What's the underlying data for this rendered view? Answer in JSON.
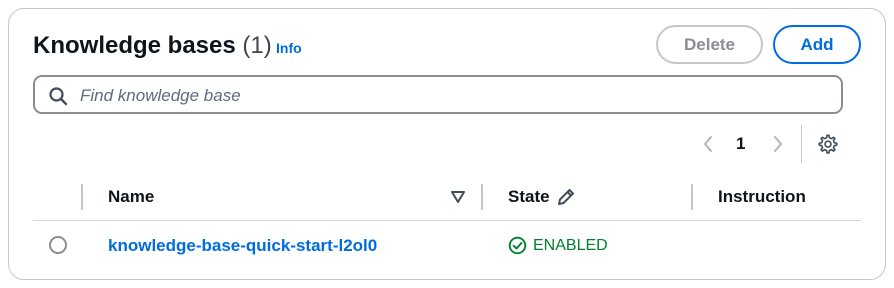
{
  "header": {
    "title": "Knowledge bases",
    "count": "(1)",
    "info_label": "Info",
    "delete_label": "Delete",
    "add_label": "Add"
  },
  "search": {
    "placeholder": "Find knowledge base"
  },
  "pagination": {
    "current_page": "1"
  },
  "table": {
    "columns": [
      "Name",
      "State",
      "Instruction"
    ],
    "rows": [
      {
        "name": "knowledge-base-quick-start-l2ol0",
        "state": "ENABLED",
        "instruction": ""
      }
    ]
  },
  "colors": {
    "link": "#006ce0",
    "enabled": "#00802f",
    "border": "#c6c6cd"
  },
  "icons": {
    "search": "search-icon",
    "prev": "chevron-left-icon",
    "next": "chevron-right-icon",
    "settings": "gear-icon",
    "sort": "caret-down-icon",
    "edit": "pencil-icon",
    "status": "check-circle-icon"
  }
}
